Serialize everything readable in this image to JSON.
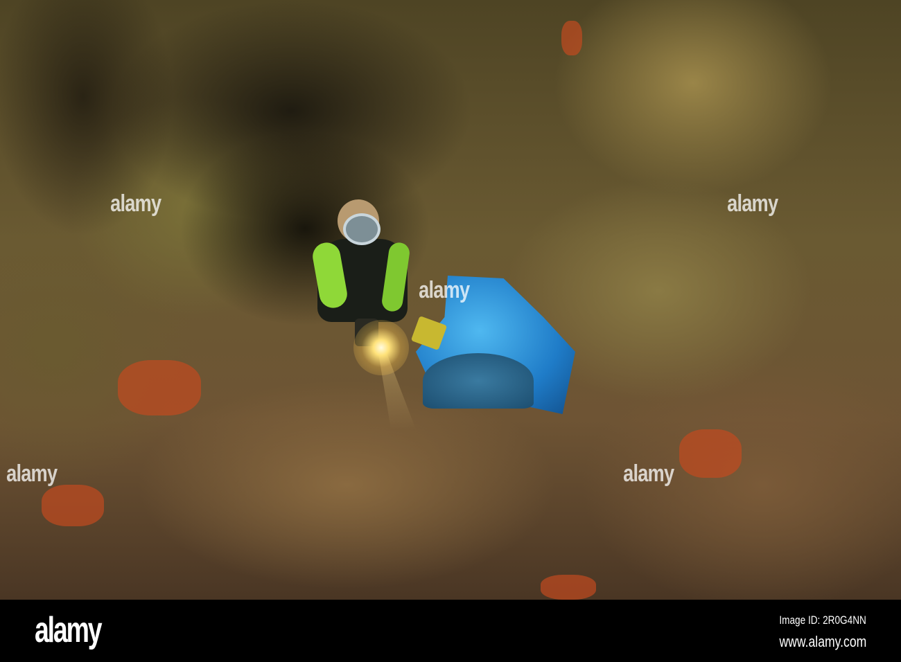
{
  "watermark": "alamy",
  "footer": {
    "logo": "alamy",
    "image_id": "Image ID: 2R0G4NN",
    "url": "www.alamy.com"
  }
}
